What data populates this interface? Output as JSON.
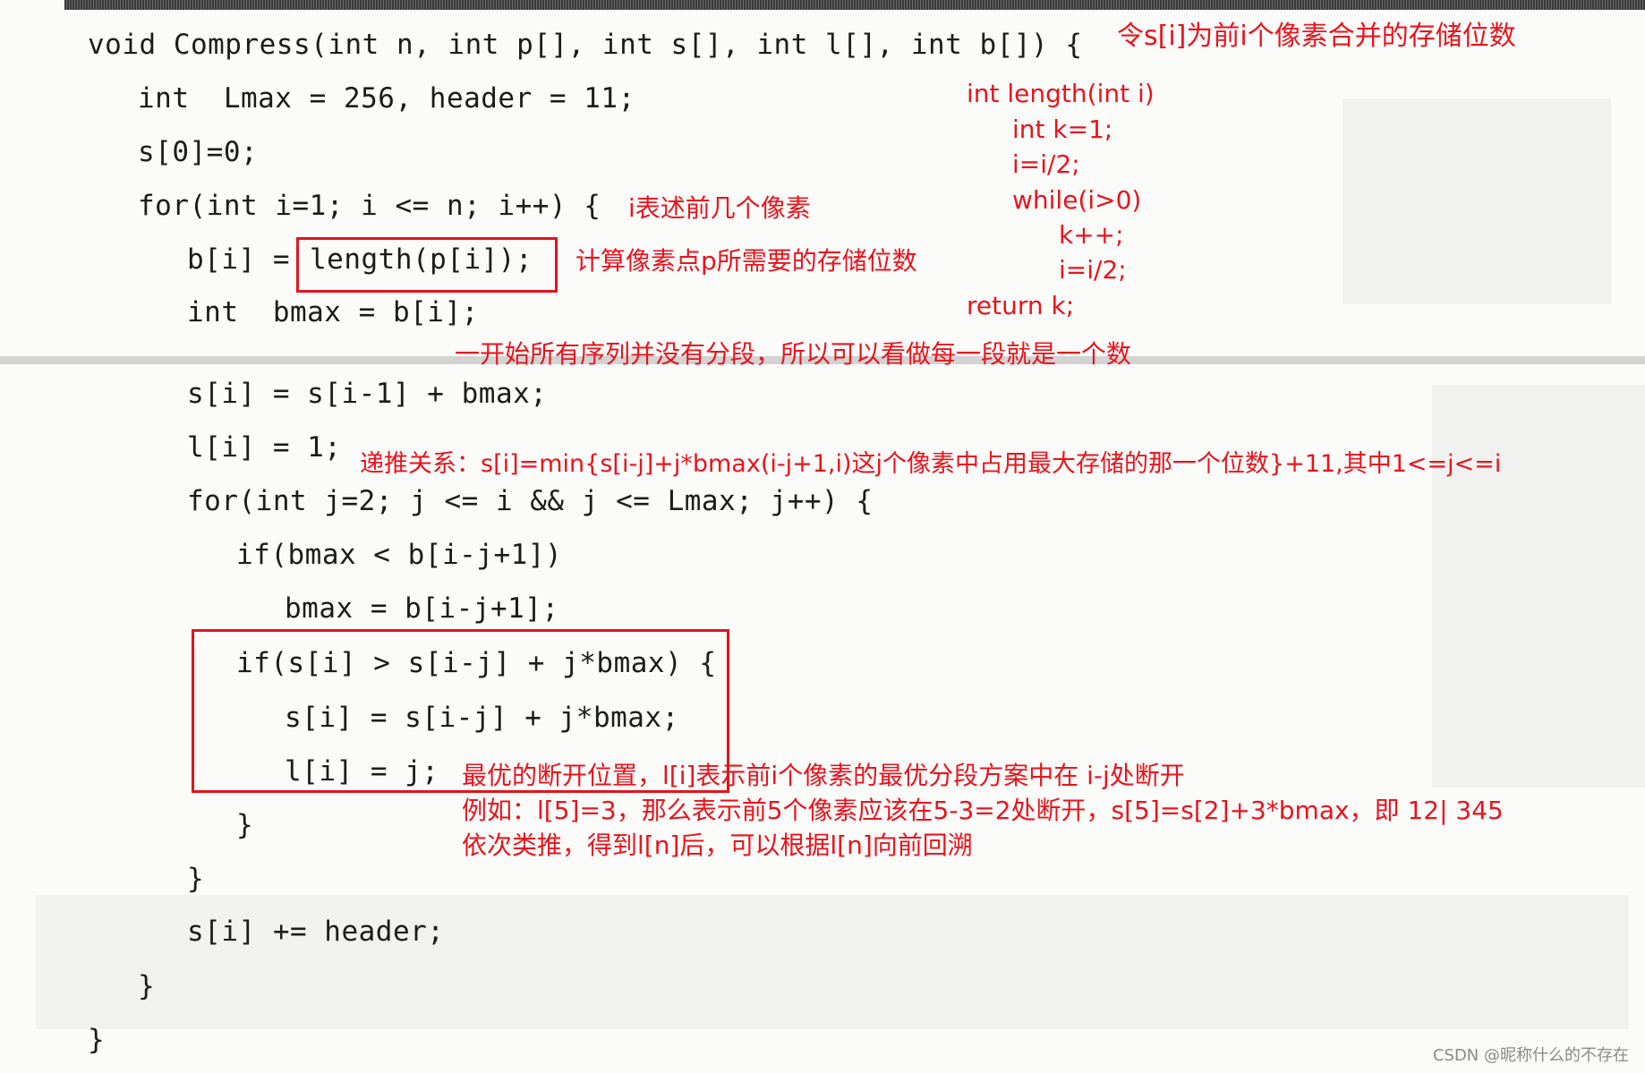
{
  "code": {
    "lines": [
      "void Compress(int n, int p[], int s[], int l[], int b[]) {",
      "int  Lmax = 256, header = 11;",
      "s[0]=0;",
      "for(int i=1; i <= n; i++) {",
      "b[i] = ",
      "length(p[i]);",
      "int  bmax = b[i];",
      "s[i] = s[i-1] + bmax;",
      "l[i] = 1;",
      "for(int j=2; j <= i && j <= Lmax; j++) {",
      "if(bmax < b[i-j+1])",
      "bmax = b[i-j+1];",
      "if(s[i] > s[i-j] + j*bmax) {",
      "s[i] = s[i-j] + j*bmax;",
      "l[i] = j;",
      "}",
      "}",
      "s[i] += header;",
      "}",
      "}"
    ]
  },
  "annotations": {
    "s_definition": "令s[i]为前i个像素合并的存储位数",
    "length_func": [
      "int length(int i)",
      "int k=1;",
      "i=i/2;",
      "while(i>0)",
      "k++;",
      "i=i/2;",
      "return k;"
    ],
    "i_meaning": "i表述前几个像素",
    "length_meaning": "计算像素点p所需要的存储位数",
    "initial_segment": "一开始所有序列并没有分段，所以可以看做每一段就是一个数",
    "recurrence": "递推关系：s[i]=min{s[i-j]+j*bmax(i-j+1,i)这j个像素中占用最大存储的那一个位数}+11,其中1<=j<=i",
    "break_position": [
      "最优的断开位置，l[i]表示前i个像素的最优分段方案中在 i-j处断开",
      "例如：l[5]=3，那么表示前5个像素应该在5-3=2处断开，s[5]=s[2]+3*bmax，即 12| 345",
      "依次类推，得到l[n]后，可以根据l[n]向前回溯"
    ]
  },
  "watermark": "CSDN @昵称什么的不存在",
  "colors": {
    "annotation": "#e8141c",
    "code": "#1c1c1c"
  }
}
